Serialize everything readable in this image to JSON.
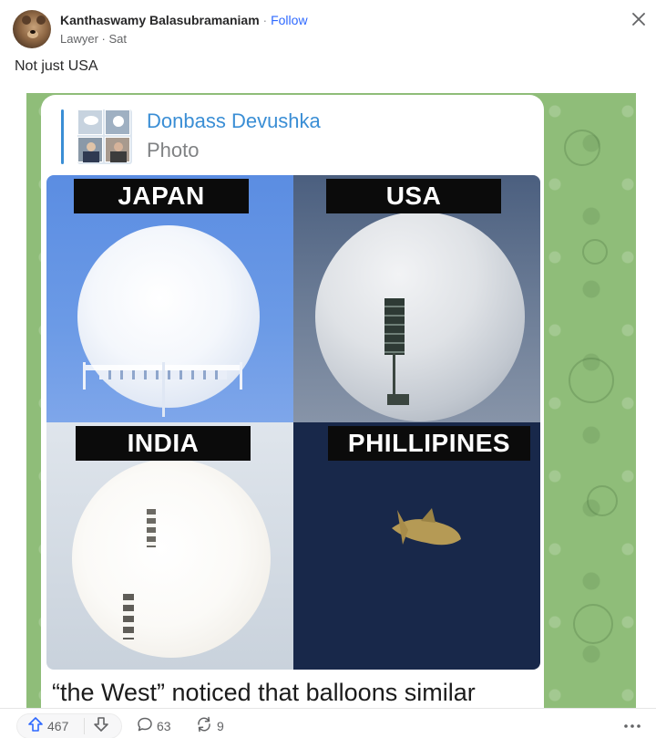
{
  "author": {
    "name": "Kanthaswamy Balasubramaniam",
    "separator": "·",
    "follow_label": "Follow",
    "credential": "Lawyer",
    "meta_separator": "·",
    "time": "Sat"
  },
  "post": {
    "text": "Not just USA"
  },
  "media": {
    "reply": {
      "sender": "Donbass Devushka",
      "type": "Photo"
    },
    "grid_labels": [
      "JAPAN",
      "USA",
      "INDIA",
      "PHILLIPINES"
    ],
    "caption": "“the West” noticed that balloons similar"
  },
  "actions": {
    "upvotes": "467",
    "comments": "63",
    "shares": "9"
  },
  "icons": {
    "close": "close-icon",
    "upvote": "upvote-arrow-icon",
    "downvote": "downvote-arrow-icon",
    "comment": "comment-bubble-icon",
    "share": "share-recycle-icon",
    "more": "more-dots-icon"
  },
  "colors": {
    "accent": "#2e69ff",
    "reply_accent": "#3a8ed5",
    "chat_background": "#8fbd79"
  }
}
